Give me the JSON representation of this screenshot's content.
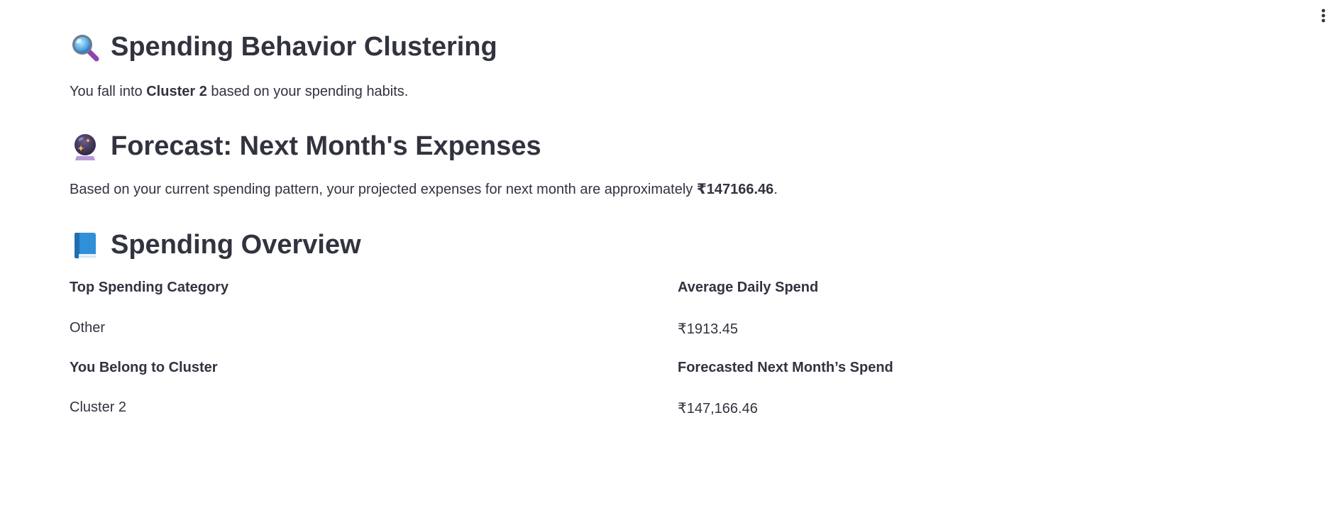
{
  "app": {
    "menu_icon": "vertical-ellipsis-icon"
  },
  "clustering": {
    "icon": "magnifying-glass-icon",
    "title": "Spending Behavior Clustering",
    "text_before": "You fall into ",
    "cluster_bold": "Cluster 2",
    "text_after": " based on your spending habits."
  },
  "forecast": {
    "icon": "crystal-ball-icon",
    "title": "Forecast: Next Month's Expenses",
    "text_before": "Based on your current spending pattern, your projected expenses for next month are approximately ",
    "amount_bold": "₹147166.46",
    "text_after": "."
  },
  "overview": {
    "icon": "blue-book-icon",
    "title": "Spending Overview",
    "metrics": [
      {
        "label": "Top Spending Category",
        "value": "Other"
      },
      {
        "label": "Average Daily Spend",
        "value": "₹1913.45"
      },
      {
        "label": "You Belong to Cluster",
        "value": "Cluster 2"
      },
      {
        "label": "Forecasted Next Month’s Spend",
        "value": "₹147,166.46"
      }
    ]
  },
  "colors": {
    "text": "#31333F",
    "background": "#FFFFFF"
  }
}
